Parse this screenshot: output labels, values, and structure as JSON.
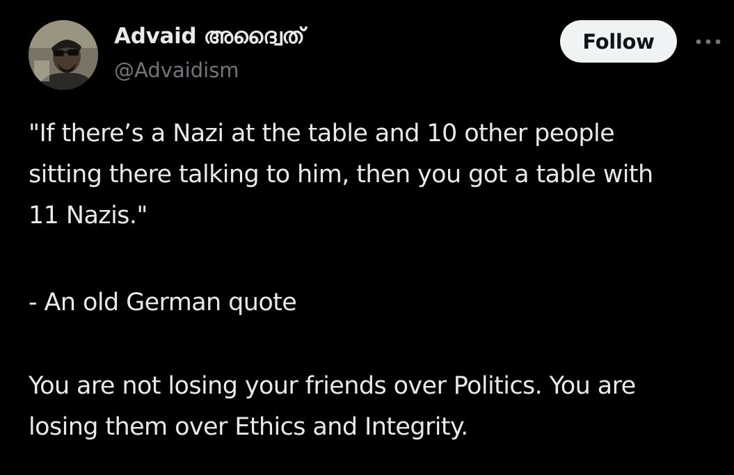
{
  "author": {
    "display_name": "Advaid അദ്വൈത്",
    "handle": "@Advaidism",
    "avatar_icon": "user-avatar-icon"
  },
  "actions": {
    "follow_label": "Follow",
    "more_icon": "more-horizontal-icon"
  },
  "tweet": {
    "quote_lines": [
      "\"If there’s a Nazi at the table and 10 other people",
      "sitting there talking to him, then you got a table with",
      "11 Nazis.\""
    ],
    "attribution": "- An old German quote",
    "comment_lines": [
      "You are not losing your friends over Politics. You are",
      "losing them over Ethics and Integrity."
    ]
  },
  "colors": {
    "background": "#000000",
    "text_primary": "#e7e9ea",
    "text_secondary": "#71767b",
    "follow_bg": "#eff3f4",
    "follow_text": "#0f1419"
  }
}
